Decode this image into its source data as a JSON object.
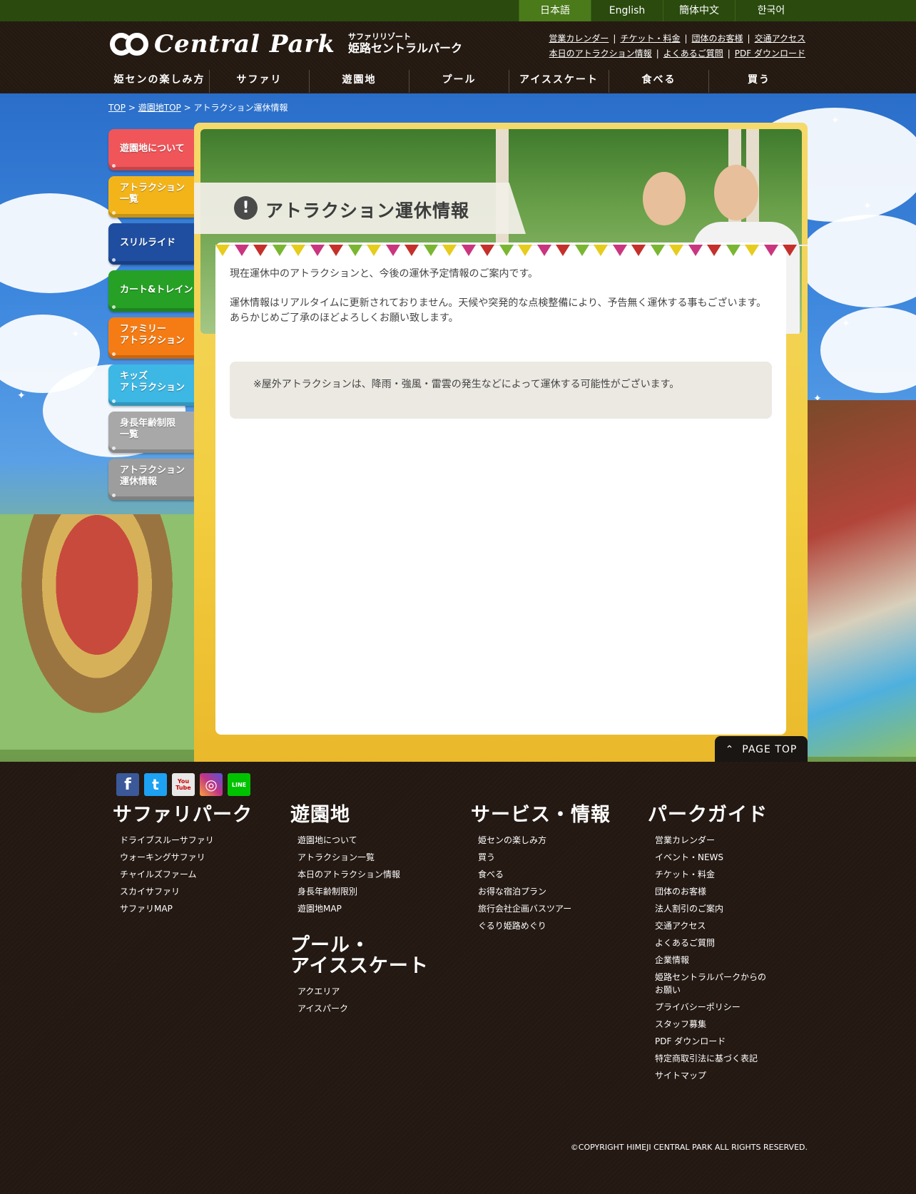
{
  "languages": [
    {
      "label": "日本語",
      "active": true
    },
    {
      "label": "English"
    },
    {
      "label": "簡体中文"
    },
    {
      "label": "한국어"
    }
  ],
  "logo": {
    "text": "Central Park",
    "sub1": "サファリリゾート",
    "sub2": "姫路セントラルパーク"
  },
  "util_links": {
    "row1": [
      "営業カレンダー",
      "チケット・料金",
      "団体のお客様",
      "交通アクセス"
    ],
    "row2": [
      "本日のアトラクション情報",
      "よくあるご質問",
      "PDF ダウンロード"
    ],
    "separator": "|"
  },
  "main_nav": [
    "姫センの楽しみ方",
    "サファリ",
    "遊園地",
    "プール",
    "アイススケート",
    "食べる",
    "買う"
  ],
  "breadcrumb": {
    "items": [
      "TOP",
      "遊園地TOP"
    ],
    "current": "アトラクション運休情報",
    "separator": ">"
  },
  "side_menu": [
    {
      "label": "遊園地について",
      "color": "#f0555a"
    },
    {
      "label": "アトラクション\n一覧",
      "color": "#f3b419"
    },
    {
      "label": "スリルライド",
      "color": "#1f4ea0"
    },
    {
      "label": "カート&トレイン",
      "color": "#27a026"
    },
    {
      "label": "ファミリー\nアトラクション",
      "color": "#f57c14"
    },
    {
      "label": "キッズ\nアトラクション",
      "color": "#3db7e4"
    },
    {
      "label": "身長年齢制限\n一覧",
      "color": "#a8a8a8"
    },
    {
      "label": "アトラクション\n運休情報",
      "color": "#9d9d9d"
    }
  ],
  "page_title": "アトラクション運休情報",
  "title_icon": "!",
  "content": {
    "p1": "現在運休中のアトラクションと、今後の運休予定情報のご案内です。",
    "p2": "運休情報はリアルタイムに更新されておりません。天候や突発的な点検整備により、予告無く運休する事もございます。",
    "p3": "あらかじめご了承のほどよろしくお願い致します。",
    "notice": "※屋外アトラクションは、降雨・強風・雷雲の発生などによって運休する可能性がございます。"
  },
  "page_top": "PAGE TOP",
  "social": [
    {
      "name": "facebook-icon",
      "label": "f",
      "color": "#3b5998"
    },
    {
      "name": "twitter-icon",
      "label": "t",
      "color": "#1da1f2"
    },
    {
      "name": "youtube-icon",
      "label": "You Tube",
      "color": "#e8e8e8"
    },
    {
      "name": "instagram-icon",
      "label": "◎",
      "color": "#c13584"
    },
    {
      "name": "line-icon",
      "label": "LINE",
      "color": "#00c300"
    }
  ],
  "footer": {
    "columns": [
      {
        "title": "サファリパーク",
        "items": [
          "ドライブスルーサファリ",
          "ウォーキングサファリ",
          "チャイルズファーム",
          "スカイサファリ",
          "サファリMAP"
        ]
      },
      {
        "title": "遊園地",
        "items": [
          "遊園地について",
          "アトラクション一覧",
          "本日のアトラクション情報",
          "身長年齢制限別",
          "遊園地MAP"
        ]
      },
      {
        "title": "プール・\nアイススケート",
        "items": [
          "アクエリア",
          "アイスパーク"
        ]
      },
      {
        "title": "サービス・情報",
        "items": [
          "姫センの楽しみ方",
          "買う",
          "食べる",
          "お得な宿泊プラン",
          "旅行会社企画バスツアー",
          "ぐるり姫路めぐり"
        ]
      },
      {
        "title": "パークガイド",
        "items": [
          "営業カレンダー",
          "イベント・NEWS",
          "チケット・料金",
          "団体のお客様",
          "法人割引のご案内",
          "交通アクセス",
          "よくあるご質問",
          "企業情報",
          "姫路セントラルパークからの\nお願い",
          "プライバシーポリシー",
          "スタッフ募集",
          "PDF ダウンロード",
          "特定商取引法に基づく表記",
          "サイトマップ"
        ]
      }
    ],
    "copyright": "©COPYRIGHT HIMEJI CENTRAL PARK ALL RIGHTS RESERVED."
  }
}
